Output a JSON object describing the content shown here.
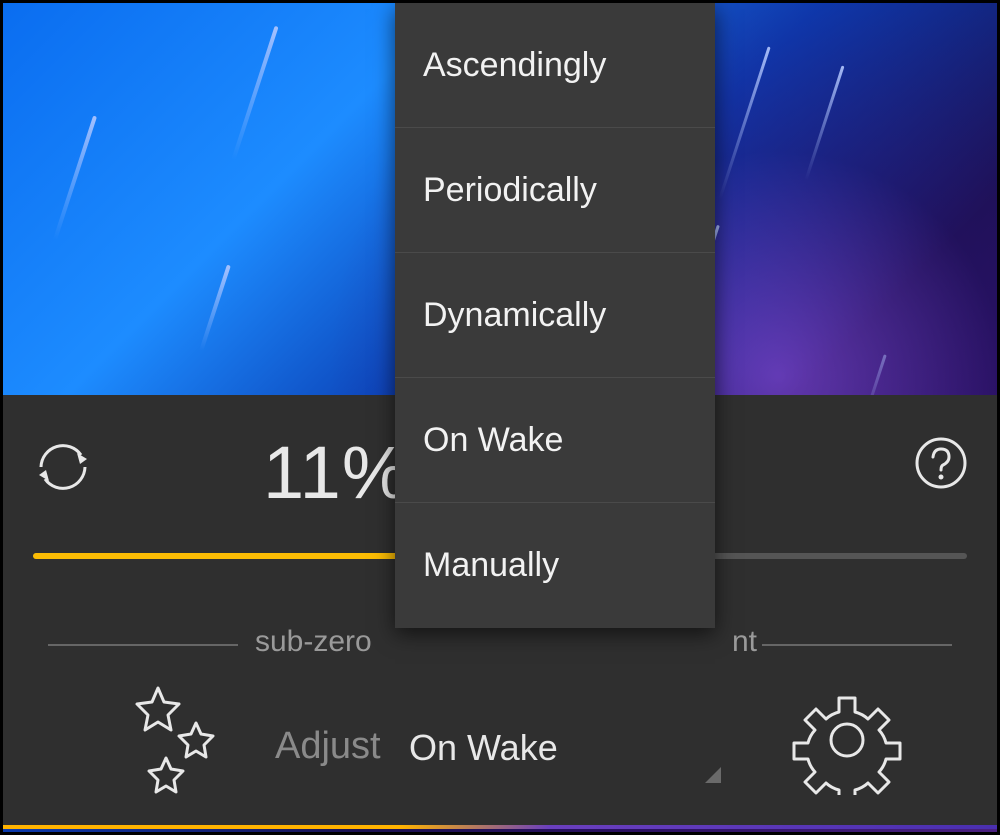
{
  "dropdown": {
    "items": [
      "Ascendingly",
      "Periodically",
      "Dynamically",
      "On Wake",
      "Manually"
    ]
  },
  "panel": {
    "percent_text": "11%",
    "slider": {
      "percent": 40
    },
    "legend": {
      "left": "sub-zero",
      "right": "nt"
    },
    "adjust_label": "Adjust",
    "adjust_value": "On Wake"
  },
  "colors": {
    "accent": "#fbbc04"
  }
}
